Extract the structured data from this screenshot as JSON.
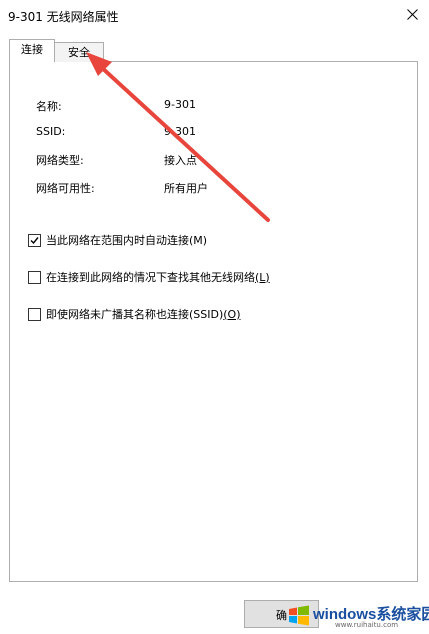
{
  "window": {
    "title": "9-301 无线网络属性"
  },
  "tabs": [
    {
      "label": "连接",
      "selected": true
    },
    {
      "label": "安全",
      "selected": false
    }
  ],
  "properties": [
    {
      "label": "名称:",
      "value": "9-301"
    },
    {
      "label": "SSID:",
      "value": "9-301"
    },
    {
      "label": "网络类型:",
      "value": "接入点"
    },
    {
      "label": "网络可用性:",
      "value": "所有用户"
    }
  ],
  "options": [
    {
      "text": "当此网络在范围内时自动连接",
      "key": "(M)",
      "checked": true
    },
    {
      "text": "在连接到此网络的情况下查找其他无线网络",
      "key": "(L)",
      "checked": false
    },
    {
      "text": "即使网络未广播其名称也连接(SSID)",
      "key": "(O)",
      "checked": false
    }
  ],
  "buttons": {
    "ok_label": "确"
  },
  "watermark": {
    "main": "windows系统家园",
    "sub": "www.ruihaitu.com"
  },
  "colors": {
    "annotation_arrow": "#e8453c",
    "watermark_text": "#1a4fa0"
  }
}
